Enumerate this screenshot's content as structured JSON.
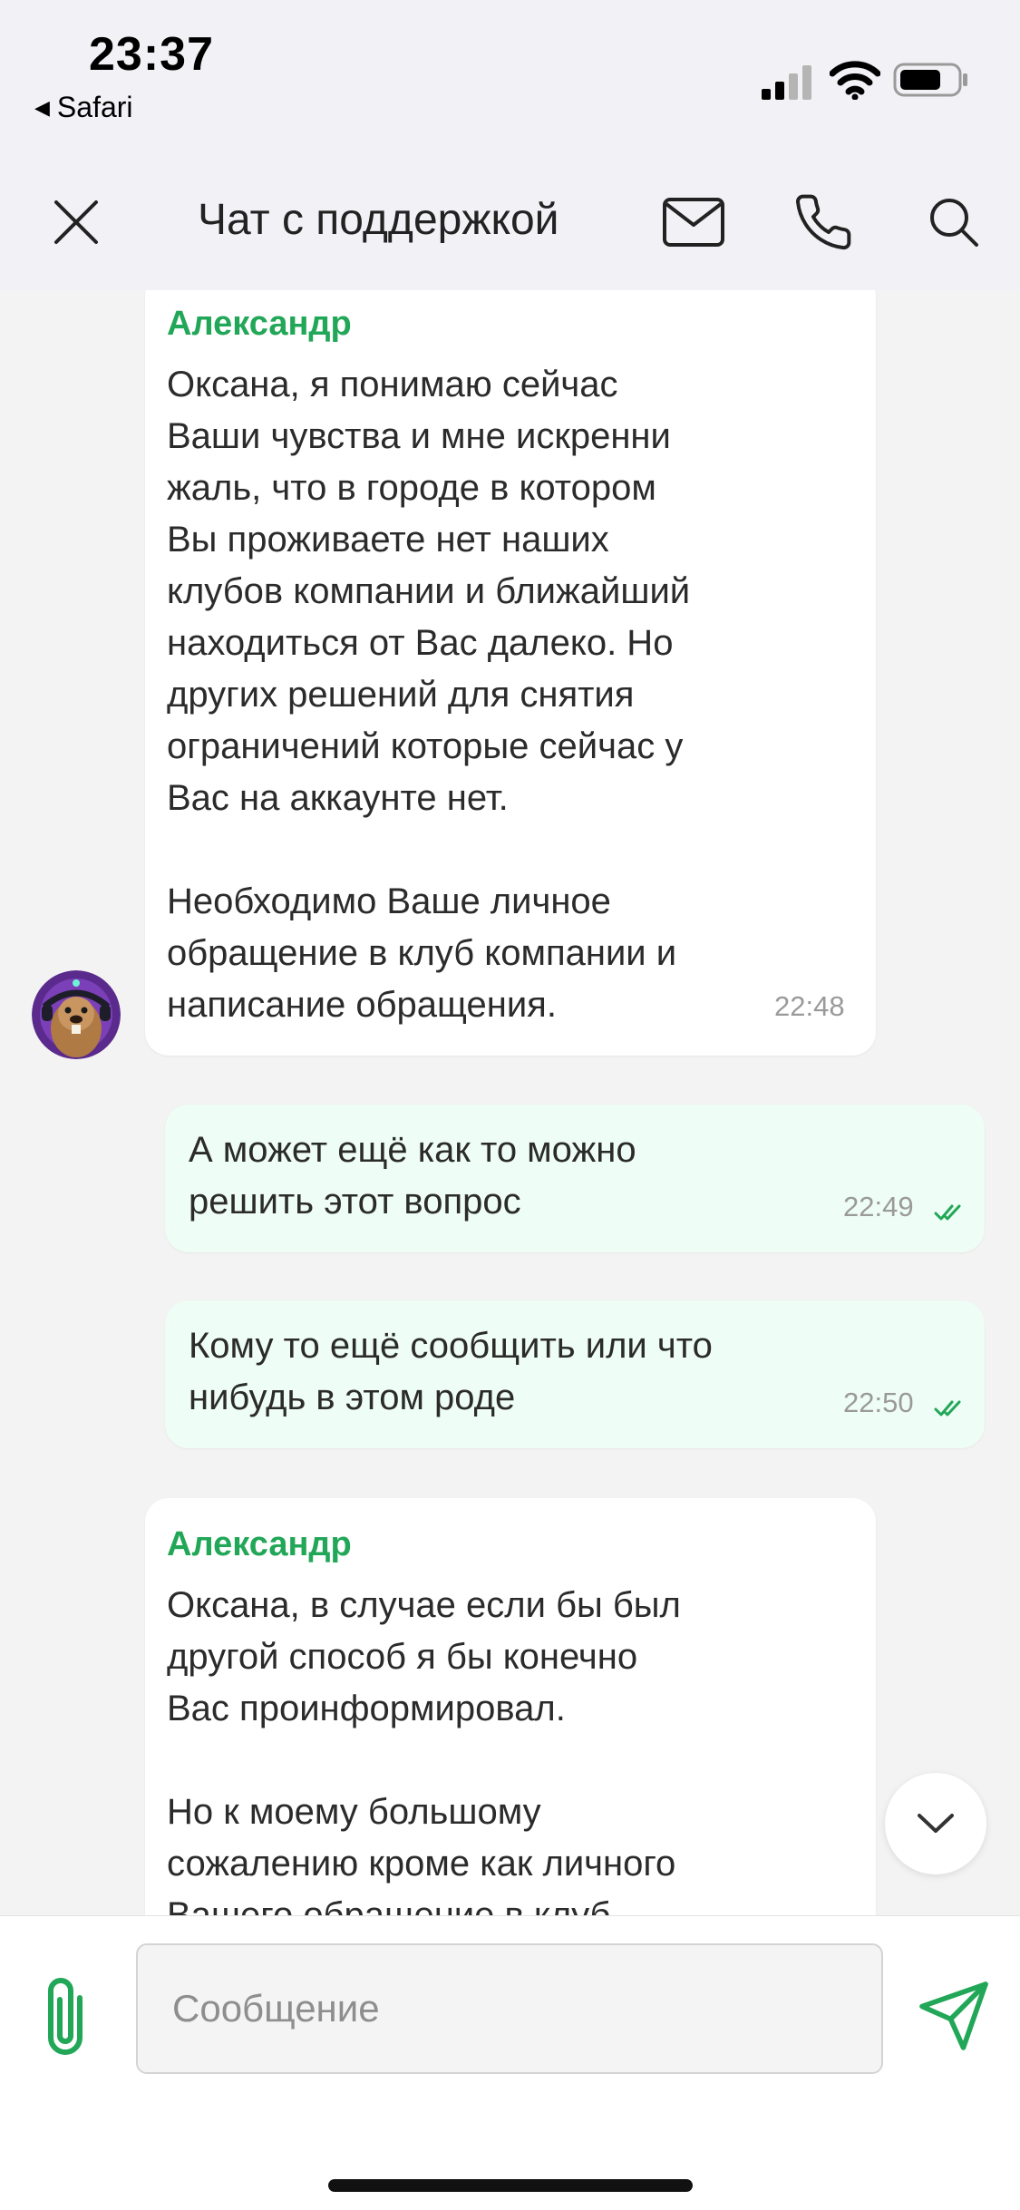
{
  "status_bar": {
    "time": "23:37",
    "back_app": "Safari",
    "icons": [
      "signal-icon",
      "wifi-icon",
      "battery-icon"
    ]
  },
  "header": {
    "title": "Чат с поддержкой",
    "icons": [
      "close-icon",
      "mail-icon",
      "phone-icon",
      "search-icon"
    ]
  },
  "colors": {
    "accent": "#21a757",
    "outgoing_bubble": "#eefdf5",
    "incoming_bubble": "#ffffff",
    "background": "#f3f3f3"
  },
  "messages": [
    {
      "direction": "incoming",
      "sender": "Александр",
      "text": "Оксана, я понимаю сейчас\nВаши чувства и мне искренни\nжаль, что в городе в котором\nВы проживаете нет наших\nклубов компании и ближайший\nнаходиться от Вас далеко. Но\nдругих решений для снятия\nограничений которые сейчас у\nВас на аккаунте нет.\n\nНеобходимо Ваше личное\nобращение в клуб компании и\nнаписание обращения.",
      "time": "22:48",
      "avatar": "beaver-avatar"
    },
    {
      "direction": "outgoing",
      "text": "А может ещё как то можно\nрешить этот вопрос",
      "time": "22:49",
      "status": "read"
    },
    {
      "direction": "outgoing",
      "text": "Кому то ещё сообщить или что\nнибудь в этом роде",
      "time": "22:50",
      "status": "read"
    },
    {
      "direction": "incoming",
      "sender": "Александр",
      "text": "Оксана, в случае если бы был\nдругой способ я бы конечно\nВас проинформировал.\n\nНо к моему большому\nсожалению кроме как личного\nВашего обращение в клуб"
    }
  ],
  "composer": {
    "placeholder": "Сообщение",
    "value": "",
    "icons": [
      "paperclip-icon",
      "send-icon"
    ]
  }
}
